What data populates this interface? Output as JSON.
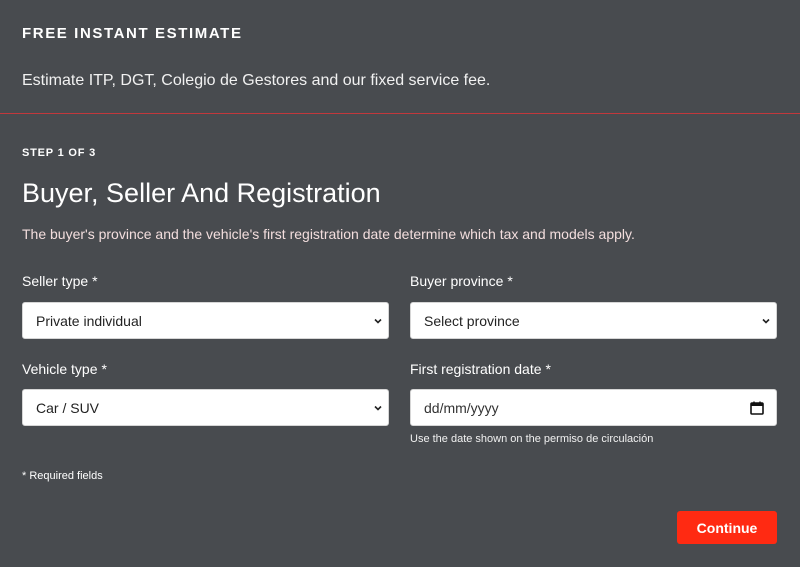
{
  "header": {
    "title": "FREE INSTANT ESTIMATE",
    "subtitle": "Estimate ITP, DGT, Colegio de Gestores and our fixed service fee."
  },
  "step": {
    "label": "STEP 1 OF 3",
    "title": "Buyer, Seller And Registration",
    "description": "The buyer's province and the vehicle's first registration date determine which tax and models apply."
  },
  "fields": {
    "seller_type": {
      "label": "Seller type",
      "required_mark": "*",
      "value": "Private individual",
      "icon": "chevron-down-icon"
    },
    "buyer_province": {
      "label": "Buyer province",
      "required_mark": "*",
      "value": "Select province",
      "icon": "chevron-down-icon"
    },
    "vehicle_type": {
      "label": "Vehicle type",
      "required_mark": "*",
      "value": "Car / SUV",
      "icon": "chevron-down-icon"
    },
    "first_registration_date": {
      "label": "First registration date",
      "required_mark": "*",
      "placeholder": "dd/mm/yyyy",
      "help": "Use the date shown on the permiso de circulación",
      "icon": "calendar-icon"
    }
  },
  "required_note": "* Required fields",
  "actions": {
    "continue_label": "Continue"
  },
  "colors": {
    "background": "#484b4f",
    "divider": "#c2383c",
    "primary_button": "#ff2a12",
    "input_background": "#ffffff"
  }
}
